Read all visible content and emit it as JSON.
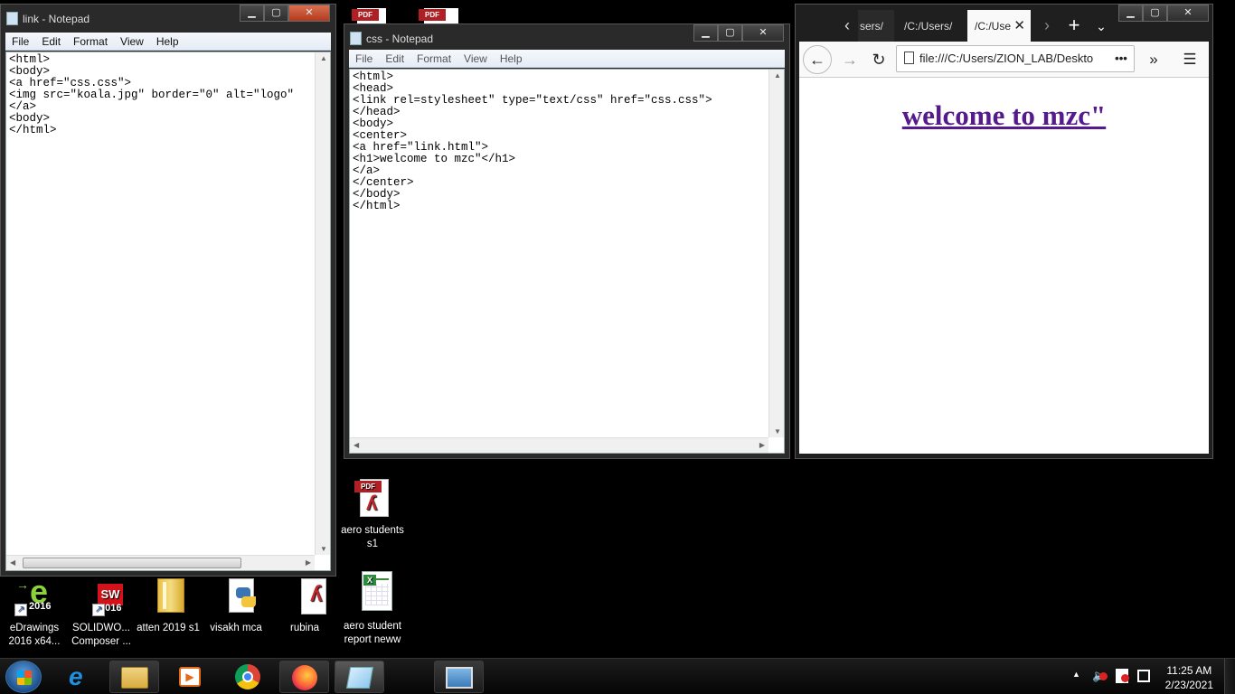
{
  "desktop": {
    "top_icons": [
      {
        "label": "PDF",
        "name": "pdf-file-1"
      },
      {
        "label": "PDF",
        "name": "pdf-file-2"
      }
    ],
    "icons": [
      {
        "label": "aero students s1",
        "type": "pdf"
      },
      {
        "label": "eDrawings 2016 x64...",
        "type": "edrawings"
      },
      {
        "label": "SOLIDWO... Composer ...",
        "type": "solidworks"
      },
      {
        "label": "atten 2019 s1",
        "type": "folder"
      },
      {
        "label": "visakh mca",
        "type": "python"
      },
      {
        "label": "rubina",
        "type": "pdf"
      },
      {
        "label": "aero student report neww",
        "type": "spreadsheet"
      }
    ],
    "edrawings_badge": "2016",
    "solidworks_badge": "2016",
    "solidworks_letters": "SW"
  },
  "notepad_link": {
    "title": "link - Notepad",
    "menu": [
      "File",
      "Edit",
      "Format",
      "View",
      "Help"
    ],
    "content": "<html>\n<body>\n<a href=\"css.css\">\n<img src=\"koala.jpg\" border=\"0\" alt=\"logo\"\n</a>\n<body>\n</html>"
  },
  "notepad_css": {
    "title": "css - Notepad",
    "menu": [
      "File",
      "Edit",
      "Format",
      "View",
      "Help"
    ],
    "content": "<html>\n<head>\n<link rel=stylesheet\" type=\"text/css\" href=\"css.css\">\n</head>\n<body>\n<center>\n<a href=\"link.html\">\n<h1>welcome to mzc\"</h1>\n</a>\n</center>\n</body>\n</html>"
  },
  "firefox": {
    "tabs": [
      {
        "label": "sers/"
      },
      {
        "label": "/C:/Users/"
      },
      {
        "label": "/C:/Use"
      }
    ],
    "url": "file:///C:/Users/ZION_LAB/Deskto",
    "page_heading": "welcome to mzc\""
  },
  "taskbar": {
    "time": "11:25 AM",
    "date": "2/23/2021"
  },
  "colors": {
    "desktop_bg": "#000000",
    "link_visited": "#551a8b",
    "pdf_red": "#b01f24"
  }
}
